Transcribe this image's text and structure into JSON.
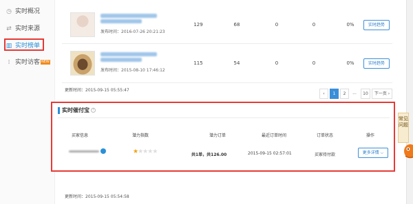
{
  "sidebar": {
    "items": [
      {
        "label": "实时概况",
        "icon": "clock-icon",
        "active": false
      },
      {
        "label": "实时来源",
        "icon": "arrows-swap-icon",
        "active": false
      },
      {
        "label": "实时榜单",
        "icon": "bar-chart-icon",
        "active": true
      },
      {
        "label": "实时访客",
        "icon": "footprints-icon",
        "active": false,
        "badge": "NEW"
      }
    ]
  },
  "products": [
    {
      "publish_time": "发布时间：2016-07-26 20:21:23",
      "values": [
        "129",
        "68",
        "0",
        "0",
        "0%"
      ],
      "action_label": "实时趋势"
    },
    {
      "publish_time": "发布时间：2015-08-10 17:46:12",
      "values": [
        "115",
        "54",
        "0",
        "0",
        "0%"
      ],
      "action_label": "实时趋势"
    }
  ],
  "list_update_time": "更新时间：2015-09-15 05:55:47",
  "pagination": {
    "prev": "‹",
    "pages": [
      "1",
      "2"
    ],
    "ellipsis": "...",
    "last": "10",
    "next": "下一页 ›",
    "current": "1"
  },
  "pending_payment": {
    "title": "实时催付宝",
    "info_icon_text": "?",
    "headers": [
      "买家信息",
      "潜力指数",
      "潜力订单",
      "最近订单时间",
      "订单状态",
      "操作"
    ],
    "row": {
      "potential_rating": 1,
      "potential_rating_max": 5,
      "potential_order": "共1单，共126.00",
      "last_order_time": "2015-09-15 02:57:01",
      "status": "买家待付款",
      "action_label": "更多详情 ⌵"
    }
  },
  "bottom_update_time": "更新时间：2015-09-15 05:54:58",
  "floating": {
    "faq_label": "常见问题"
  },
  "colors": {
    "accent": "#2b8fd8",
    "highlight_border": "#e53935",
    "star": "#f3a110"
  }
}
